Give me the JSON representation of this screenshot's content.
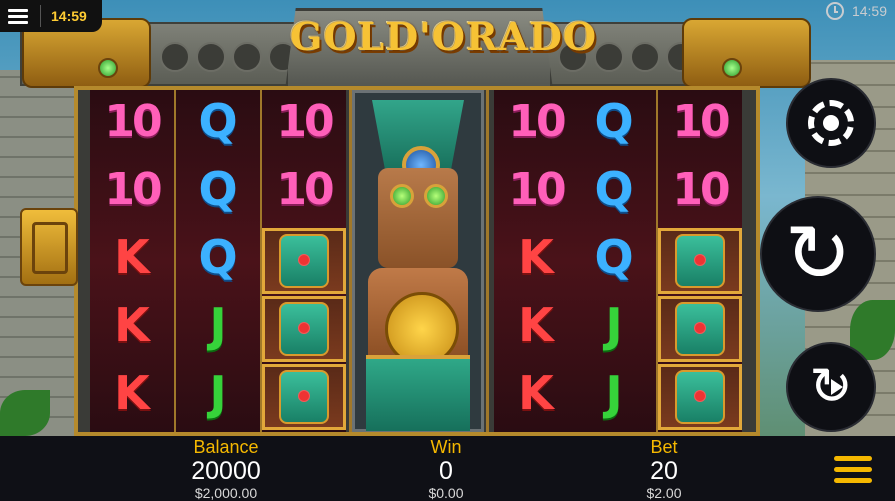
{
  "header": {
    "time": "14:59",
    "status_time": "14:59",
    "logo": "GOLD'ORADO"
  },
  "reels": [
    [
      "10",
      "10",
      "K",
      "K",
      "K"
    ],
    [
      "Q",
      "Q",
      "Q",
      "J",
      "J"
    ],
    [
      "10",
      "10",
      "idol",
      "idol",
      "idol"
    ],
    [],
    [
      "10",
      "10",
      "K",
      "K",
      "K"
    ],
    [
      "Q",
      "Q",
      "Q",
      "J",
      "J"
    ],
    [
      "10",
      "10",
      "idol",
      "idol",
      "idol"
    ]
  ],
  "bottom": {
    "balance_label": "Balance",
    "balance_value": "20000",
    "balance_money": "$2,000.00",
    "win_label": "Win",
    "win_value": "0",
    "win_money": "$0.00",
    "bet_label": "Bet",
    "bet_value": "20",
    "bet_money": "$2.00"
  },
  "icons": {
    "menu": "hamburger-icon",
    "clock": "clock-icon",
    "settings": "chip-icon",
    "spin": "spin-icon",
    "autoplay": "autoplay-icon",
    "game_menu": "menu-icon"
  }
}
